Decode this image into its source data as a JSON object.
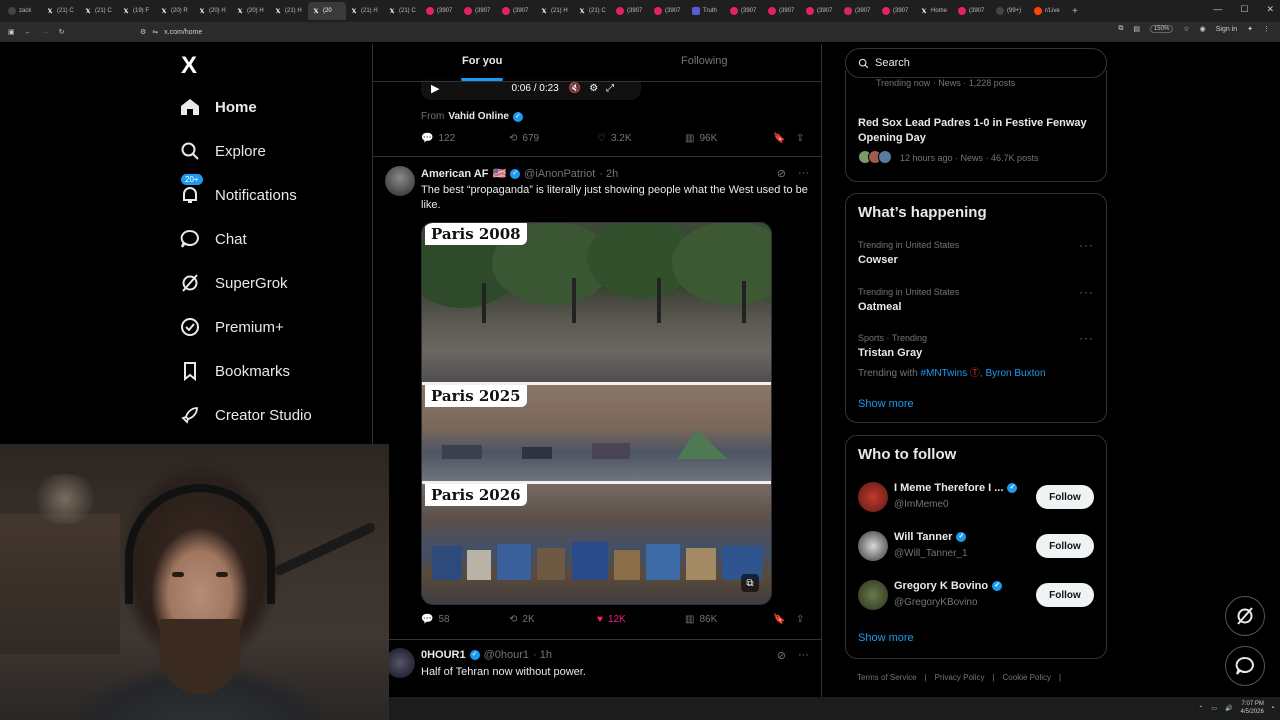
{
  "browser": {
    "tabs": [
      {
        "label": "zack",
        "fav": "page"
      },
      {
        "label": "(21) C",
        "fav": "x"
      },
      {
        "label": "(21) C",
        "fav": "x"
      },
      {
        "label": "(19) F",
        "fav": "x"
      },
      {
        "label": "(20) R",
        "fav": "x"
      },
      {
        "label": "(20) H",
        "fav": "x"
      },
      {
        "label": "(20) H",
        "fav": "x"
      },
      {
        "label": "(21) H",
        "fav": "x"
      },
      {
        "label": "(20",
        "fav": "x",
        "active": true
      },
      {
        "label": "(21) H",
        "fav": "x"
      },
      {
        "label": "(21) C",
        "fav": "x"
      },
      {
        "label": "(3907",
        "fav": "yt"
      },
      {
        "label": "(3907",
        "fav": "yt"
      },
      {
        "label": "(3907",
        "fav": "yt"
      },
      {
        "label": "(21) H",
        "fav": "x"
      },
      {
        "label": "(21) C",
        "fav": "x"
      },
      {
        "label": "(3907",
        "fav": "yt"
      },
      {
        "label": "(3907",
        "fav": "yt"
      },
      {
        "label": "Truth",
        "fav": "t"
      },
      {
        "label": "(3907",
        "fav": "yt"
      },
      {
        "label": "(3907",
        "fav": "yt"
      },
      {
        "label": "(3907",
        "fav": "yt"
      },
      {
        "label": "(3907",
        "fav": "yt"
      },
      {
        "label": "(3907",
        "fav": "yt"
      },
      {
        "label": "Home",
        "fav": "x"
      },
      {
        "label": "(3907",
        "fav": "yt"
      },
      {
        "label": "(99+)",
        "fav": "page"
      },
      {
        "label": "r/Live",
        "fav": "r"
      }
    ],
    "url": "x.com/home",
    "zoom": "150%",
    "signin": "Sign in"
  },
  "nav": {
    "logo": "X",
    "items": [
      {
        "label": "Home",
        "icon": "home-icon"
      },
      {
        "label": "Explore",
        "icon": "search-icon"
      },
      {
        "label": "Notifications",
        "icon": "bell-icon",
        "badge": "20+"
      },
      {
        "label": "Chat",
        "icon": "chat-icon"
      },
      {
        "label": "SuperGrok",
        "icon": "grok-icon"
      },
      {
        "label": "Premium+",
        "icon": "premium-icon"
      },
      {
        "label": "Bookmarks",
        "icon": "bookmark-icon"
      },
      {
        "label": "Creator Studio",
        "icon": "rocket-icon"
      }
    ]
  },
  "feed": {
    "tabs": [
      "For you",
      "Following"
    ],
    "prev_tweet": {
      "video_time": "0:06 / 0:23",
      "from_label": "From",
      "from_name": "Vahid Online",
      "replies": "122",
      "reposts": "679",
      "likes": "3.2K",
      "views": "96K"
    },
    "tweet": {
      "name": "American AF",
      "flag": "🇺🇸",
      "handle": "@iAnonPatriot",
      "time": "· 2h",
      "text": "The best “propaganda” is literally just showing people what the West used to be like.",
      "panels": [
        "Paris 2008",
        "Paris 2025",
        "Paris 2026"
      ],
      "replies": "58",
      "reposts": "2K",
      "likes": "12K",
      "views": "86K"
    },
    "next_tweet": {
      "name": "0HOUR1",
      "handle": "@0hour1",
      "time": "· 1h",
      "text": "Half of Tehran now without power."
    }
  },
  "right": {
    "search_placeholder": "Search",
    "top_trend": {
      "meta_partial": "Trending now · News · 1,228 posts",
      "title": "Red Sox Lead Padres 1-0 in Festive Fenway Opening Day",
      "meta": "12 hours ago · News · 46.7K posts"
    },
    "whats_happening": {
      "title": "What’s happening",
      "trends": [
        {
          "meta": "Trending in United States",
          "name": "Cowser"
        },
        {
          "meta": "Trending in United States",
          "name": "Oatmeal"
        },
        {
          "meta": "Sports · Trending",
          "name": "Tristan Gray",
          "with_label": "Trending with",
          "with_links": [
            "#MNTwins",
            "Byron Buxton"
          ]
        }
      ],
      "show_more": "Show more"
    },
    "who_to_follow": {
      "title": "Who to follow",
      "users": [
        {
          "name": "I Meme Therefore I ...",
          "handle": "@ImMeme0",
          "button": "Follow"
        },
        {
          "name": "Will Tanner",
          "handle": "@Will_Tanner_1",
          "button": "Follow"
        },
        {
          "name": "Gregory K Bovino",
          "handle": "@GregoryKBovino",
          "button": "Follow"
        }
      ],
      "show_more": "Show more"
    },
    "footer": [
      "Terms of Service",
      "|",
      "Privacy Policy",
      "|",
      "Cookie Policy",
      "|"
    ]
  },
  "taskbar": {
    "time": "7:07 PM",
    "date": "4/5/2026"
  }
}
